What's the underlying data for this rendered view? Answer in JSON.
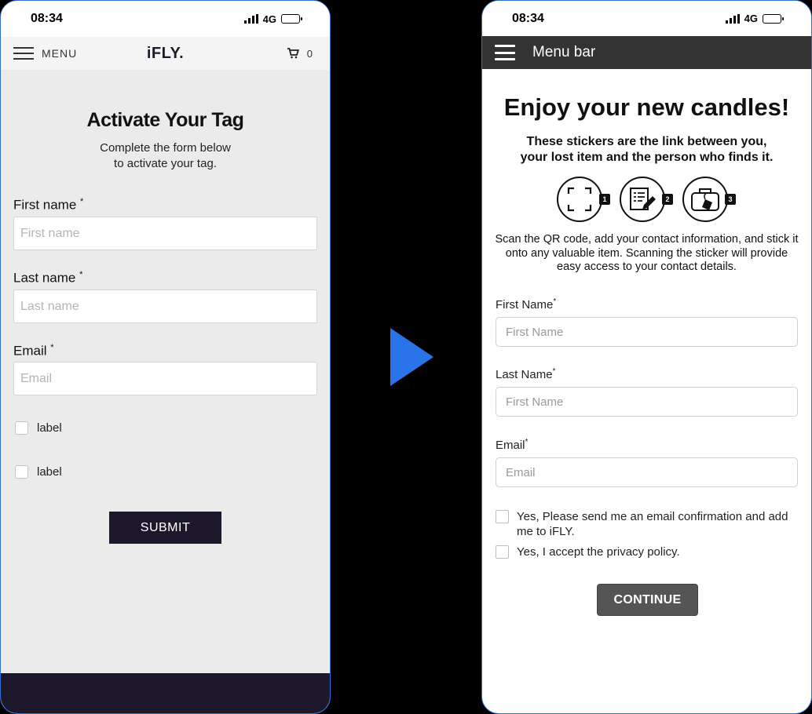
{
  "left_phone": {
    "status": {
      "time": "08:34",
      "network": "4G"
    },
    "header": {
      "menu_label": "MENU",
      "logo": "iFLY.",
      "cart_count": "0"
    },
    "title": "Activate Your Tag",
    "subtitle_line1": "Complete the form below",
    "subtitle_line2": "to activate your tag.",
    "fields": [
      {
        "label": "First name",
        "required": "*",
        "placeholder": "First name"
      },
      {
        "label": "Last name",
        "required": "*",
        "placeholder": "Last name"
      },
      {
        "label": "Email",
        "required": "*",
        "placeholder": "Email"
      }
    ],
    "checkboxes": [
      {
        "label": "label"
      },
      {
        "label": "label"
      }
    ],
    "submit_label": "SUBMIT"
  },
  "right_phone": {
    "status": {
      "time": "08:34",
      "network": "4G"
    },
    "header": {
      "menu_label": "Menu bar"
    },
    "title": "Enjoy your new candles!",
    "subtitle_line1": "These stickers are the link between you,",
    "subtitle_line2": "your lost item and the person who finds it.",
    "steps": [
      {
        "number": "1",
        "icon": "qr-scan-icon"
      },
      {
        "number": "2",
        "icon": "form-edit-icon"
      },
      {
        "number": "3",
        "icon": "luggage-tag-icon"
      }
    ],
    "description": "Scan the QR code, add your contact information, and stick it onto any valuable item. Scanning the sticker will provide easy access to your contact details.",
    "fields": [
      {
        "label": "First Name",
        "required": "*",
        "placeholder": "First Name"
      },
      {
        "label": "Last Name",
        "required": "*",
        "placeholder": "First Name"
      },
      {
        "label": "Email",
        "required": "*",
        "placeholder": "Email"
      }
    ],
    "checkboxes": [
      {
        "label": "Yes, Please send me an email confirmation and add me to iFLY."
      },
      {
        "label": "Yes, I accept the privacy policy."
      }
    ],
    "continue_label": "CONTINUE"
  },
  "colors": {
    "arrow": "#2a73e8",
    "phone_border": "#2f6fd6",
    "left_dark": "#1d172c",
    "right_header": "#333333"
  }
}
